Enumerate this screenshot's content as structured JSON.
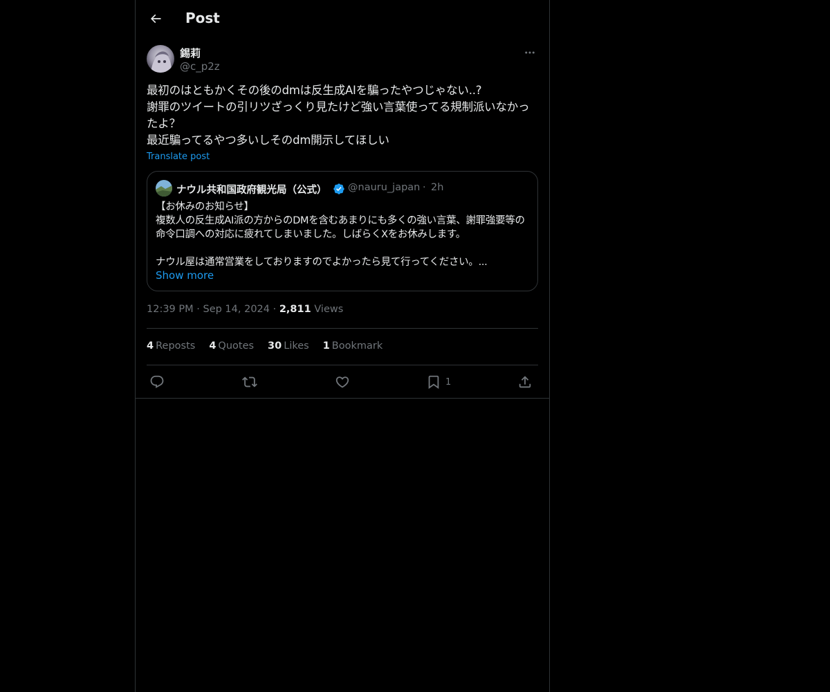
{
  "header": {
    "title": "Post"
  },
  "author": {
    "name": "錫莉",
    "handle": "@c_p2z"
  },
  "tweet": {
    "text": "最初のはともかくその後のdmは反生成AIを騙ったやつじゃない..?\n謝罪のツイートの引リツざっくり見たけど強い言葉使ってる規制派いなかったよ？\n最近騙ってるやつ多いしそのdm開示してほしい",
    "translate_label": "Translate post"
  },
  "quote": {
    "name": "ナウル共和国政府観光局（公式）",
    "handle": "@nauru_japan",
    "separator": "·",
    "time": "2h",
    "text": "【お休みのお知らせ】\n複数人の反生成AI派の方からのDMを含むあまりにも多くの強い言葉、謝罪強要等の命令口調への対応に疲れてしまいました。しばらくXをお休みします。\n\nナウル屋は通常営業をしておりますのでよかったら見て行ってください。...",
    "show_more": "Show more"
  },
  "meta": {
    "time": "12:39 PM",
    "sep": "·",
    "date": "Sep 14, 2024",
    "views_count": "2,811",
    "views_label": "Views"
  },
  "stats": {
    "reposts_count": "4",
    "reposts_label": "Reposts",
    "quotes_count": "4",
    "quotes_label": "Quotes",
    "likes_count": "30",
    "likes_label": "Likes",
    "bookmarks_count": "1",
    "bookmarks_label": "Bookmark"
  },
  "actions": {
    "bookmark_count": "1"
  },
  "icons": {
    "back": "arrow-left-icon",
    "more": "ellipsis-icon",
    "verified": "verified-badge-icon",
    "reply": "reply-icon",
    "repost": "repost-icon",
    "like": "heart-icon",
    "bookmark": "bookmark-icon",
    "share": "share-icon"
  },
  "colors": {
    "background": "#000000",
    "text": "#e7e9ea",
    "muted": "#71767b",
    "accent": "#1d9bf0",
    "border": "#2f3336"
  }
}
